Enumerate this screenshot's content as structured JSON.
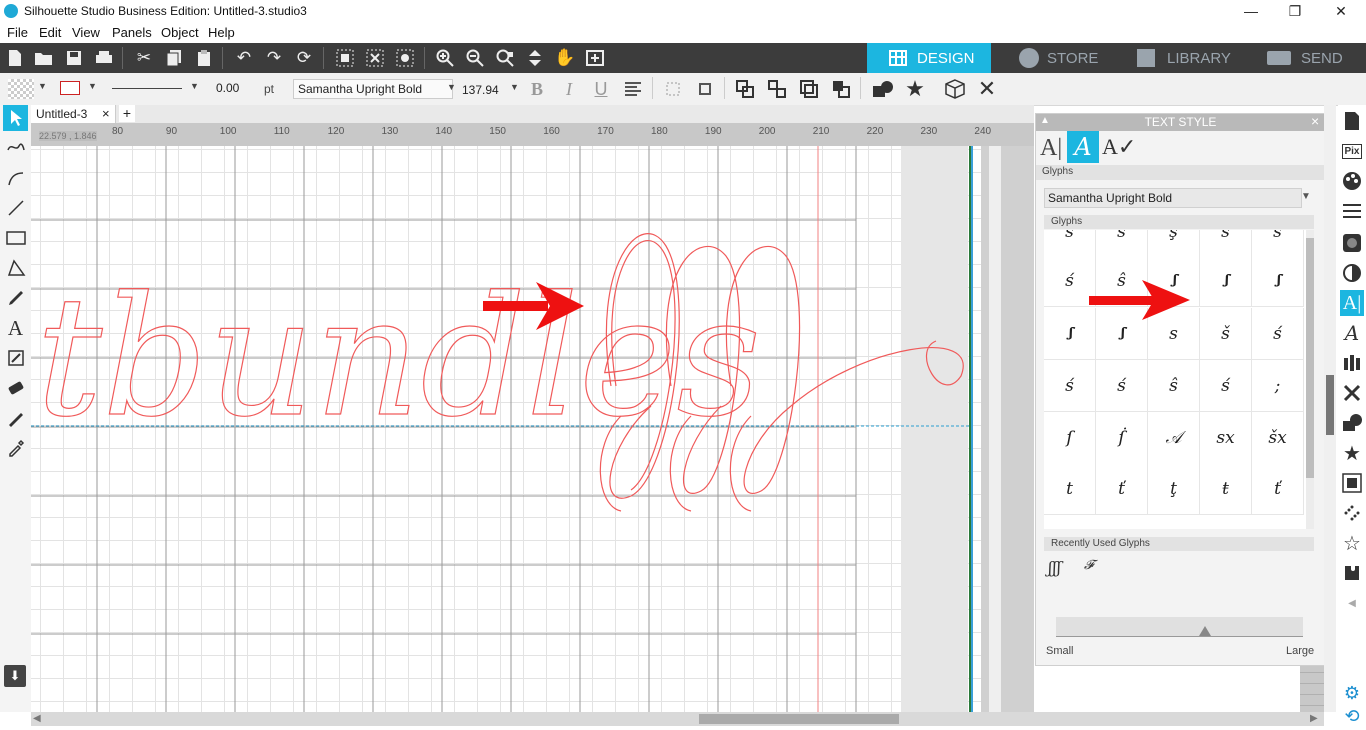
{
  "window": {
    "title": "Silhouette Studio Business Edition: Untitled-3.studio3",
    "controls": [
      "—",
      "❐",
      "✕"
    ]
  },
  "menu": [
    "File",
    "Edit",
    "View",
    "Panels",
    "Object",
    "Help"
  ],
  "nav_tabs": [
    "DESIGN",
    "STORE",
    "LIBRARY",
    "SEND"
  ],
  "toolbar2": {
    "line_width": "0.00",
    "line_unit": "pt",
    "font": "Samantha Upright Bold",
    "font_size": "137.94",
    "bold": "B",
    "italic": "I",
    "underline": "U"
  },
  "doc_tab": {
    "name": "Untitled-3",
    "close": "×",
    "add": "+"
  },
  "ruler": {
    "coords": "22.579 , 1.846",
    "labels": [
      "80",
      "90",
      "100",
      "110",
      "120",
      "130",
      "140",
      "150",
      "160",
      "170",
      "180",
      "190",
      "200",
      "210",
      "220",
      "230",
      "240"
    ]
  },
  "canvas_text": "tbundles",
  "panel": {
    "title": "TEXT STYLE",
    "close": "×",
    "section": "Glyphs",
    "font": "Samantha Upright Bold",
    "glyphs_header": "Glyphs",
    "glyph_rows": [
      [
        "ś",
        "ŝ",
        "ş",
        "š",
        "ś"
      ],
      [
        "ś",
        "ŝ",
        "ʃʃʃ",
        "ʃʃʃ",
        "ʃʃʃ"
      ],
      [
        "ʃʃʃ",
        "ʃʃʃ",
        "s",
        "š",
        "ś"
      ],
      [
        "ś",
        "ś",
        "ŝ",
        "ś",
        ";"
      ],
      [
        "ſ",
        "ẛ",
        "𝒜",
        "sx",
        "šx"
      ],
      [
        "t",
        "ť",
        "ţ",
        "ŧ",
        "ť"
      ]
    ],
    "recent_header": "Recently Used Glyphs",
    "recent": [
      "ʃʃʃ",
      "𝓕"
    ],
    "slider_small": "Small",
    "slider_large": "Large"
  },
  "colors": {
    "accent": "#1cb6e0",
    "toolbar_dark": "#3c3c3c",
    "outline_red": "#f05a5a",
    "arrow_red": "#ee1111"
  }
}
